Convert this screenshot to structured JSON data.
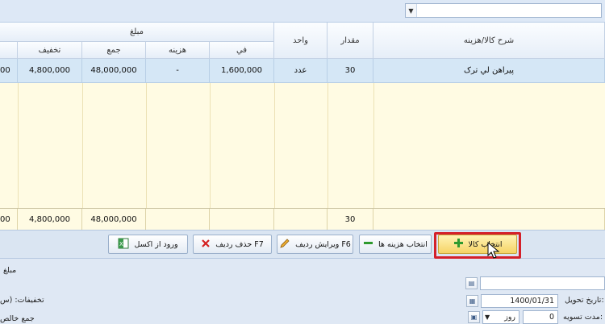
{
  "grid": {
    "group_header": "مبلغ",
    "headers": {
      "description": "شرح کالا/هزینه",
      "quantity": "مقدار",
      "unit": "واحد",
      "unit_price": "في",
      "cost": "هزینه",
      "sum": "جمع",
      "discount": "تخفیف"
    },
    "row": {
      "description": "پیراهن لي ترک",
      "quantity": "30",
      "unit": "عدد",
      "unit_price": "1,600,000",
      "cost": "-",
      "sum": "48,000,000",
      "discount": "4,800,000",
      "edge": "00"
    },
    "footer": {
      "quantity": "30",
      "sum": "48,000,000",
      "discount": "4,800,000",
      "edge": "00"
    }
  },
  "toolbar": {
    "select_goods": "انتخاب کالا",
    "select_costs": "انتخاب هزینه ها",
    "edit_row": "ویرایش ردیف F6",
    "delete_row": "حذف ردیف F7",
    "import_excel": "ورود از اکسل"
  },
  "form": {
    "delivery_date_label": "تاریخ تحویل:",
    "delivery_date_value": "1400/01/31",
    "settlement_label": "مدت تسویه:",
    "settlement_value": "0",
    "settlement_unit": "روز",
    "amount_label": "مبلغ",
    "discounts_label": "تخفیفات: (س",
    "net_total_label": "جمع خالص"
  },
  "colors": {
    "highlight": "#d4202a",
    "selected_row": "#d5e7f6",
    "grid_background": "#fffbe3"
  }
}
